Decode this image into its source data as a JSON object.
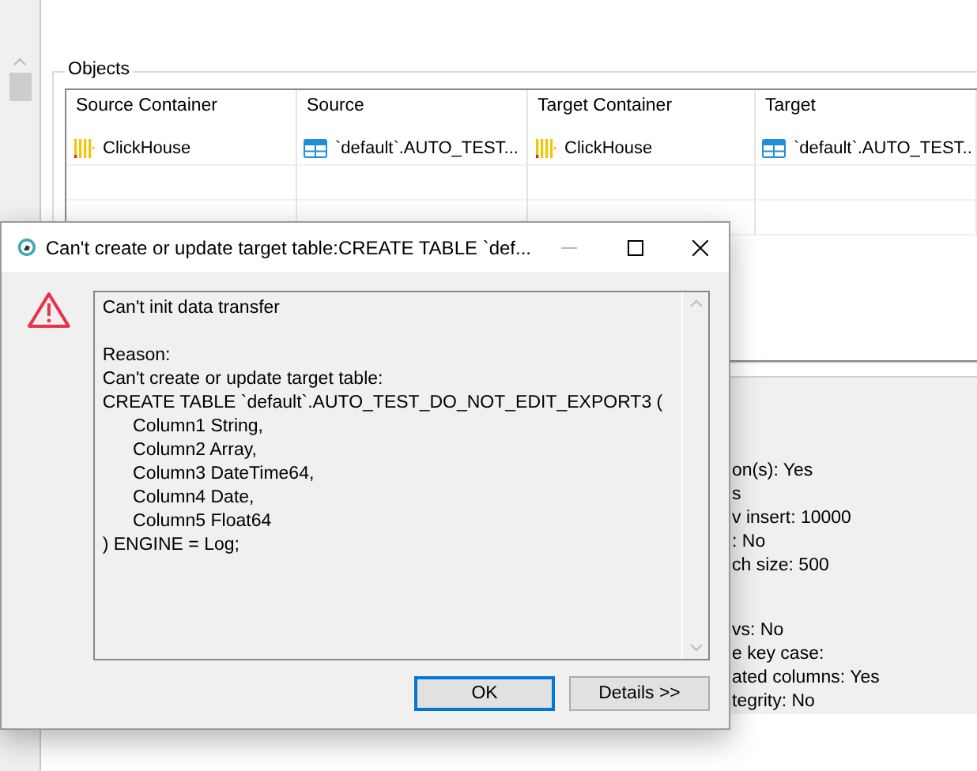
{
  "objects_panel": {
    "title": "Objects",
    "columns": [
      "Source Container",
      "Source",
      "Target Container",
      "Target"
    ],
    "rows": [
      {
        "source_container": "ClickHouse",
        "source": "`default`.AUTO_TEST...",
        "target_container": "ClickHouse",
        "target": "`default`.AUTO_TEST.."
      }
    ]
  },
  "settings_groups": [
    [
      "on(s): Yes",
      "s",
      "v insert: 10000",
      ": No",
      "ch size: 500"
    ],
    [
      "vs: No",
      "e key case:",
      "ated columns: Yes",
      "tegrity: No"
    ]
  ],
  "dialog": {
    "title": "Can't create or update target table:CREATE TABLE `def...",
    "message_heading": "Can't init data transfer",
    "message_lines": [
      "Reason:",
      "Can't create or update target table:",
      "CREATE TABLE `default`.AUTO_TEST_DO_NOT_EDIT_EXPORT3 (",
      "\tColumn1 String,",
      "\tColumn2 Array,",
      "\tColumn3 DateTime64,",
      "\tColumn4 Date,",
      "\tColumn5 Float64",
      ") ENGINE = Log;"
    ],
    "buttons": [
      {
        "label": "OK",
        "default": true
      },
      {
        "label": "Details >>",
        "default": false
      }
    ]
  }
}
